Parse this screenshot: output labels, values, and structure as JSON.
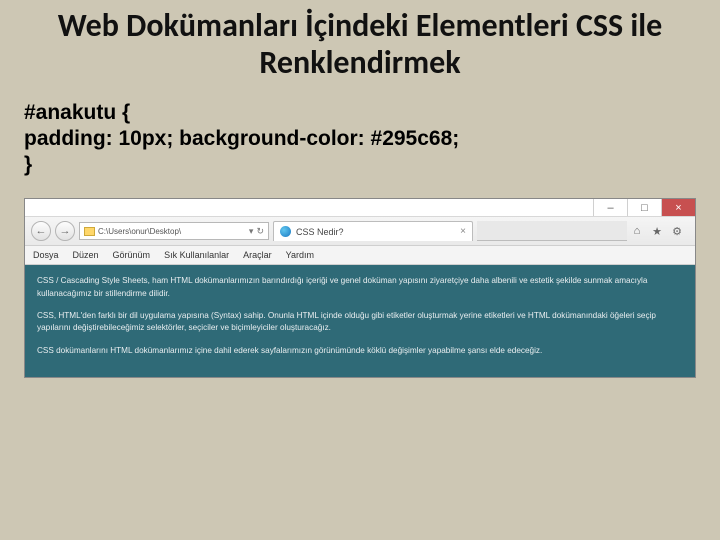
{
  "title": "Web Dokümanları İçindeki Elementleri CSS ile Renklendirmek",
  "code": {
    "l1": "#anakutu {",
    "l2": "padding: 10px; background-color: #295c68;",
    "l3": "}"
  },
  "window": {
    "min": "–",
    "max": "□",
    "close": "×"
  },
  "nav": {
    "back": "←",
    "fwd": "→",
    "path": "C:\\Users\\onur\\Desktop\\",
    "dropdown": "▾",
    "refresh": "↻"
  },
  "tab": {
    "label": "CSS Nedir?",
    "close": "×"
  },
  "toolbar": {
    "home": "⌂",
    "star": "★",
    "gear": "⚙"
  },
  "menu": {
    "m1": "Dosya",
    "m2": "Düzen",
    "m3": "Görünüm",
    "m4": "Sık Kullanılanlar",
    "m5": "Araçlar",
    "m6": "Yardım"
  },
  "page": {
    "p1": "CSS / Cascading Style Sheets, ham HTML dokümanlarımızın barındırdığı içeriği ve genel doküman yapısını ziyaretçiye daha albenili ve estetik şekilde sunmak amacıyla kullanacağımız bir stillendirme dilidir.",
    "p2": "CSS, HTML'den farklı bir dil uygulama yapısına (Syntax) sahip. Onunla HTML içinde olduğu gibi etiketler oluşturmak yerine etiketleri ve HTML dokümanındaki öğeleri seçip yapılarını değiştirebileceğimiz selektörler, seçiciler ve biçimleyiciler oluşturacağız.",
    "p3": "CSS dokümanlarını HTML dokümanlarımız içine dahil ederek sayfalarımızın görünümünde köklü değişimler yapabilme şansı elde edeceğiz."
  }
}
